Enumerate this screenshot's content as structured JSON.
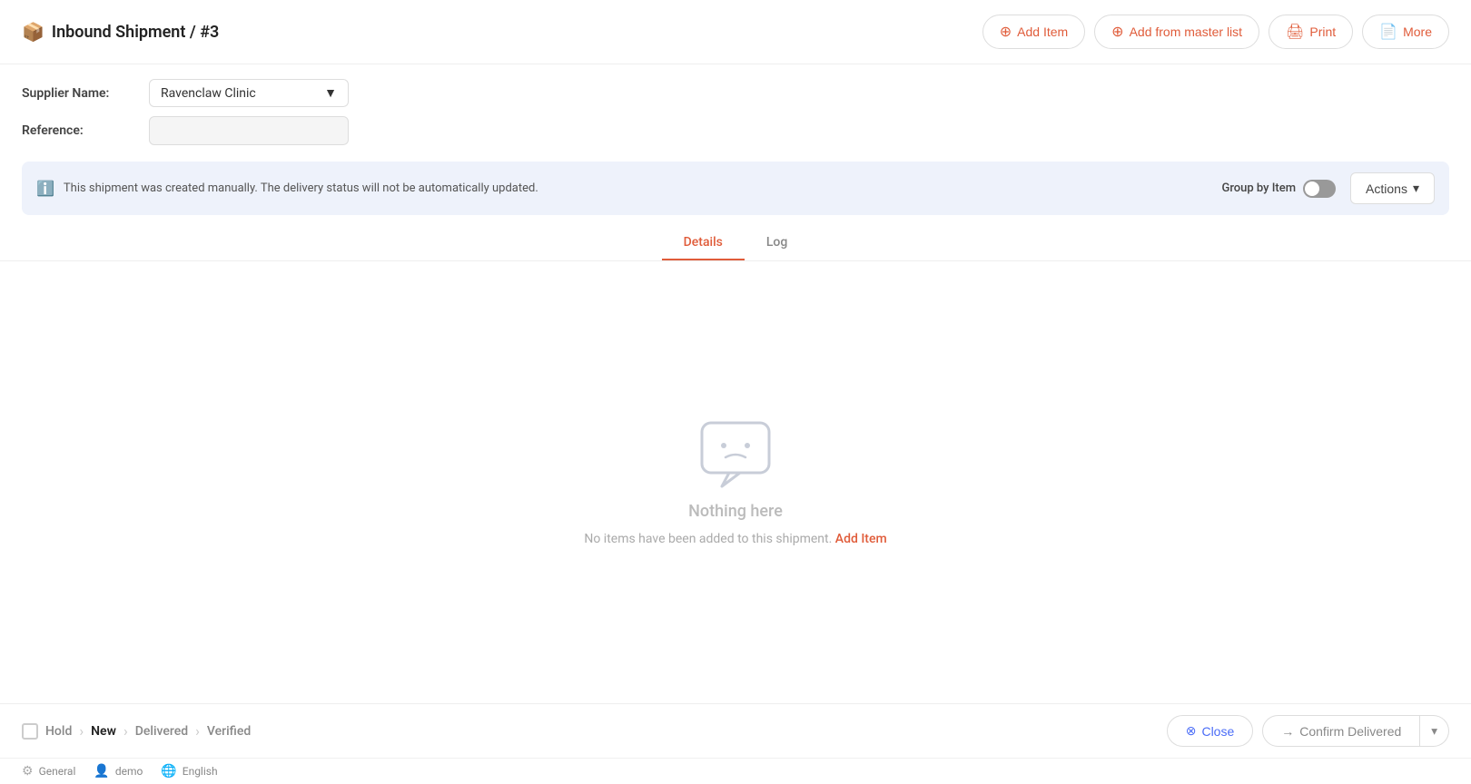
{
  "header": {
    "icon": "📦",
    "title": "Inbound Shipment",
    "separator": "/",
    "id": "#3",
    "buttons": {
      "add_item": "Add Item",
      "add_from_master": "Add from master list",
      "print": "Print",
      "more": "More"
    }
  },
  "form": {
    "supplier_label": "Supplier Name:",
    "supplier_value": "Ravenclaw Clinic",
    "reference_label": "Reference:",
    "reference_placeholder": ""
  },
  "banner": {
    "text": "This shipment was created manually. The delivery status will not be automatically updated.",
    "group_by_label": "Group by Item",
    "toggle_active": false,
    "actions_label": "Actions"
  },
  "tabs": [
    {
      "label": "Details",
      "active": true
    },
    {
      "label": "Log",
      "active": false
    }
  ],
  "empty_state": {
    "title": "Nothing here",
    "subtitle_prefix": "No items have been added to this shipment.",
    "add_item_link": "Add Item"
  },
  "bottom_bar": {
    "steps": [
      {
        "label": "Hold",
        "active": false
      },
      {
        "label": "New",
        "active": true
      },
      {
        "label": "Delivered",
        "active": false
      },
      {
        "label": "Verified",
        "active": false
      }
    ],
    "close_label": "Close",
    "confirm_label": "Confirm Delivered"
  },
  "footer": {
    "general_label": "General",
    "user_label": "demo",
    "language_label": "English"
  }
}
